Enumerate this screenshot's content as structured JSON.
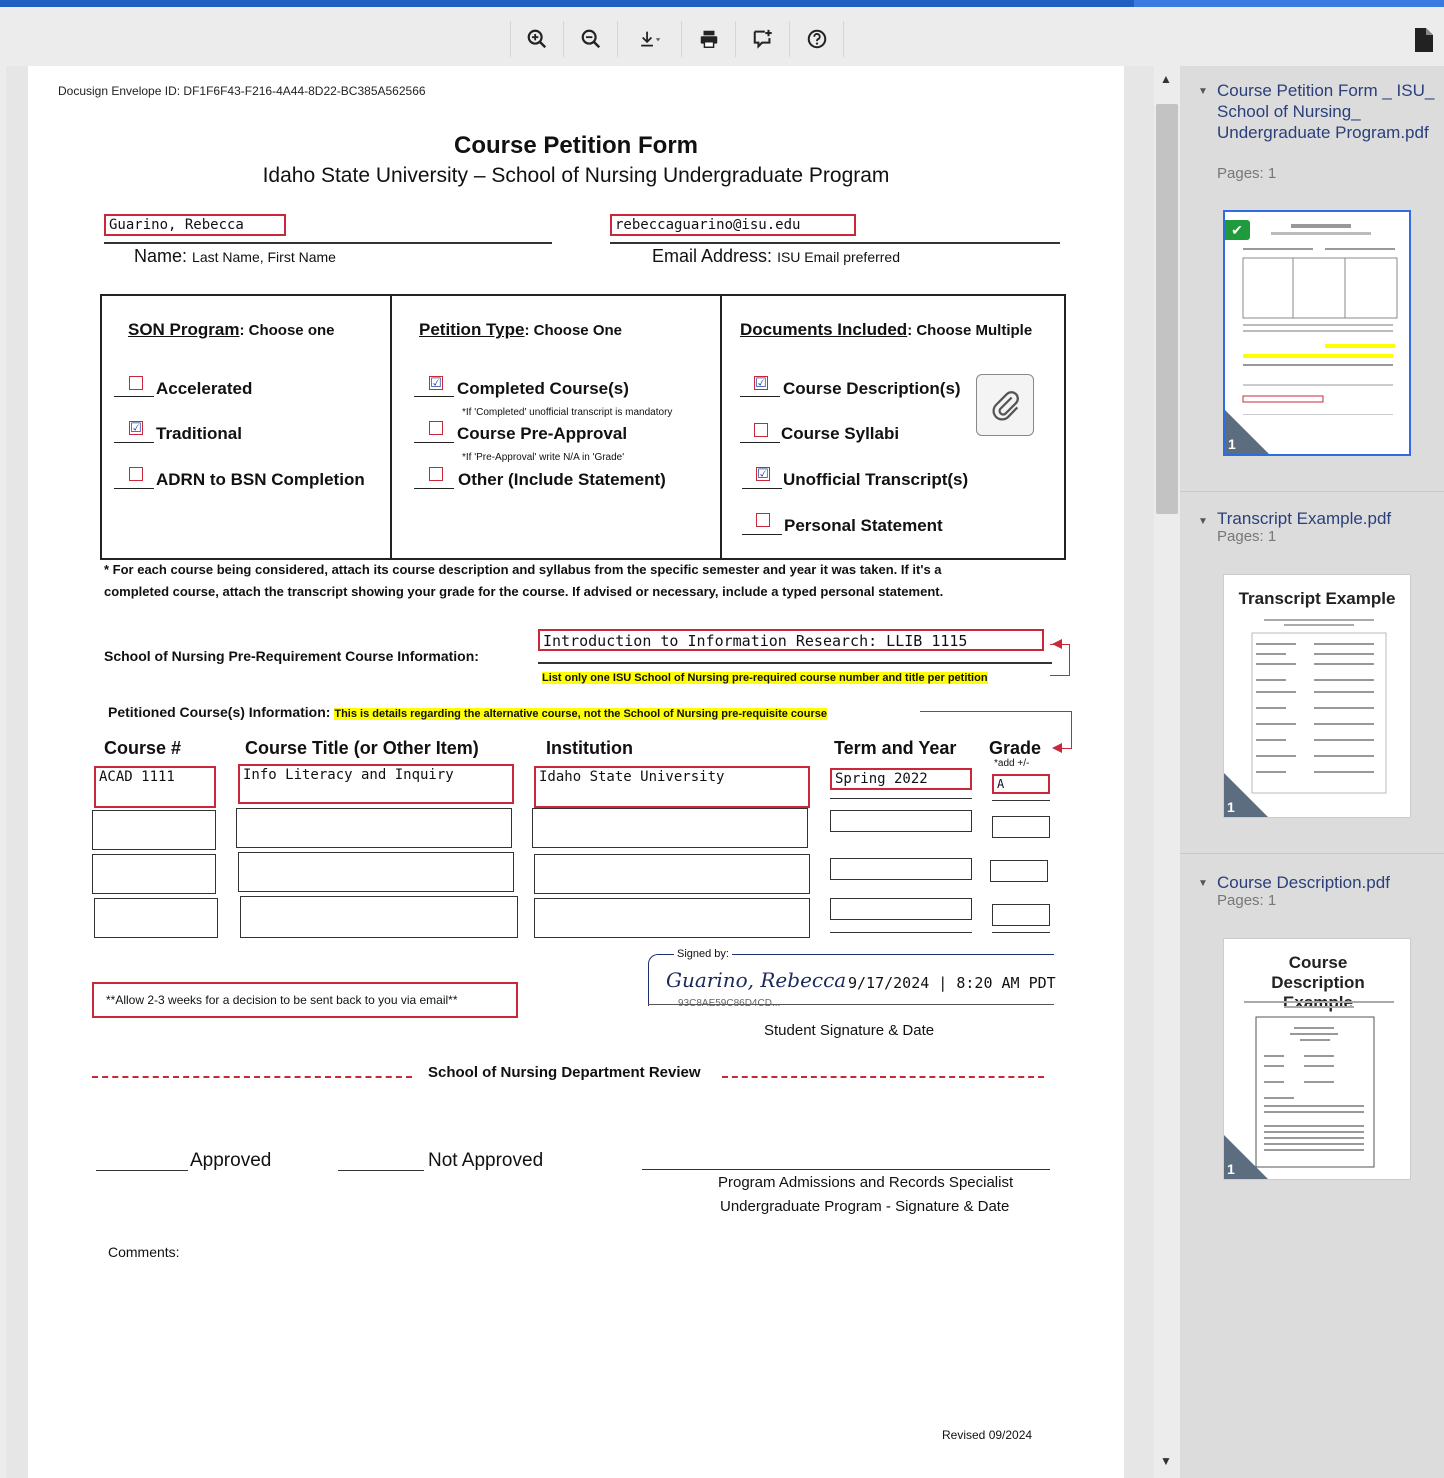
{
  "toolbar": {
    "zoom_in": "⊕",
    "zoom_out": "⊖",
    "print": "🖶"
  },
  "viewer": {
    "envelope_id": "Docusign Envelope ID: DF1F6F43-F216-4A44-8D22-BC385A562566",
    "form_title": "Course Petition Form",
    "form_subtitle": "Idaho State University – School of Nursing Undergraduate Program",
    "name_value": "Guarino, Rebecca",
    "email_value": "rebeccaguarino@isu.edu",
    "name_label": "Name:",
    "name_hint": "Last Name, First Name",
    "email_label": "Email Address:",
    "email_hint": "ISU Email preferred",
    "son_header": "SON Program",
    "son_hint": ": Choose one",
    "son_options": [
      "Accelerated",
      "Traditional",
      "ADRN to BSN Completion"
    ],
    "petition_header": "Petition Type",
    "petition_hint": ": Choose One",
    "petition_options": [
      "Completed Course(s)",
      "Course Pre-Approval",
      "Other (Include Statement)"
    ],
    "petition_notes": [
      "*If 'Completed' unofficial transcript is mandatory",
      "*If 'Pre-Approval' write N/A in 'Grade'"
    ],
    "docs_header": "Documents Included",
    "docs_hint": ": Choose Multiple",
    "docs_options": [
      "Course Description(s)",
      "Course Syllabi",
      "Unofficial Transcript(s)",
      "Personal Statement"
    ],
    "checked_mark": "☑",
    "instructions_1": "* For each course being considered, attach its course description and syllabus from the specific semester and year it was taken. If it's a",
    "instructions_2": "completed course, attach the transcript showing your grade for the course. If advised or necessary, include a typed personal statement.",
    "prereq_label": "School of Nursing Pre-Requirement Course Information:",
    "prereq_value": "Introduction to Information Research: LLIB 1115",
    "prereq_note": "List only one ISU School of Nursing pre-required course number and title per petition",
    "petitioned_label": "Petitioned Course(s) Information:",
    "petitioned_note": "This is details regarding the alternative course, not the School of Nursing pre-requisite course",
    "columns": [
      "Course #",
      "Course Title (or Other Item)",
      "Institution",
      "Term and Year",
      "Grade"
    ],
    "grade_note": "*add +/-",
    "row1": {
      "course": "ACAD 1111",
      "title": "Info Literacy and Inquiry",
      "institution": "Idaho State University",
      "term": "Spring 2022",
      "grade": "A"
    },
    "signed_by": "Signed by:",
    "signature": "Guarino, Rebecca",
    "sign_datetime": "9/17/2024 | 8:20 AM PDT",
    "sign_hash": "93C8AE59C86D4CD...",
    "student_sig_label": "Student Signature & Date",
    "allow_note": "**Allow 2-3 weeks for a decision to be sent back to you via email**",
    "dept_review": "School of Nursing Department Review",
    "approved": "Approved",
    "not_approved": "Not Approved",
    "specialist_1": "Program Admissions and Records Specialist",
    "specialist_2": "Undergraduate Program - Signature & Date",
    "comments": "Comments:",
    "revised": "Revised 09/2024"
  },
  "sidebar": {
    "docs": [
      {
        "name": "Course Petition Form _ ISU_ School of Nursing_ Undergraduate Program.pdf",
        "pages": "Pages: 1",
        "thumb_title": "",
        "page_num": "1"
      },
      {
        "name": "Transcript Example.pdf",
        "pages": "Pages: 1",
        "thumb_title": "Transcript Example",
        "page_num": "1"
      },
      {
        "name": "Course Description.pdf",
        "pages": "Pages: 1",
        "thumb_title": "Course Description Example",
        "page_num": "1"
      }
    ]
  }
}
